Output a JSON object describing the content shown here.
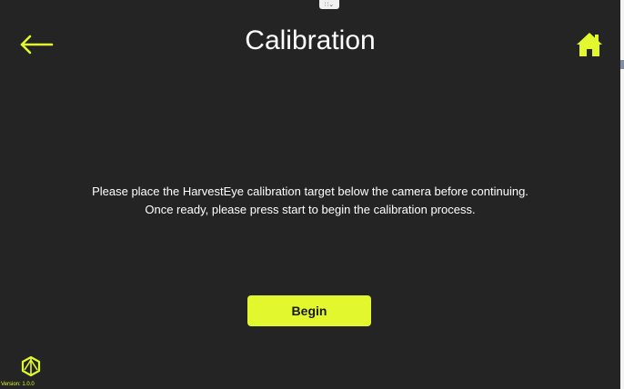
{
  "header": {
    "title": "Calibration",
    "back_icon": "arrow-left-icon",
    "home_icon": "home-icon"
  },
  "window_handle": {
    "text": "∷⌄"
  },
  "instructions": {
    "line1": "Please place the HarvestEye calibration target below the camera before continuing.",
    "line2": "Once ready, please press start to begin the calibration process."
  },
  "actions": {
    "begin_label": "Begin"
  },
  "footer": {
    "logo_icon": "harvesteye-logo-icon",
    "version": "Version: 1.0.0"
  },
  "colors": {
    "background": "#242424",
    "accent": "#e2f72e",
    "text": "#ffffff"
  }
}
